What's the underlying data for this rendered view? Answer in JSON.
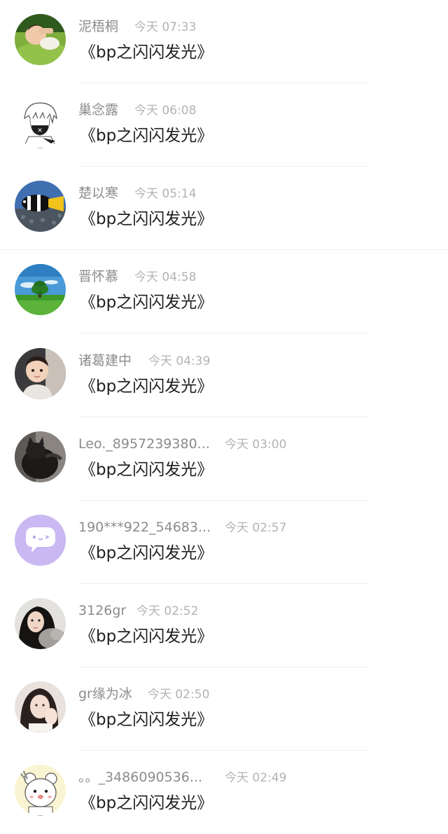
{
  "messages": [
    {
      "name": "泥梧桐",
      "time": "今天 07:33",
      "text": "《bp之闪闪发光》",
      "avatar": "boy-on-grass"
    },
    {
      "name": "巢念露",
      "time": "今天 06:08",
      "text": "《bp之闪闪发光》",
      "avatar": "anime-mask-sketch"
    },
    {
      "name": "楚以寒",
      "time": "今天 05:14",
      "text": "《bp之闪闪发光》",
      "avatar": "clownfish"
    },
    {
      "name": "晋怀慕",
      "time": "今天 04:58",
      "text": "《bp之闪闪发光》",
      "avatar": "tree-landscape"
    },
    {
      "name": "诸葛建中",
      "time": "今天 04:39",
      "text": "《bp之闪闪发光》",
      "avatar": "toddler"
    },
    {
      "name": "Leo._8957239380...",
      "time": "今天 03:00",
      "text": "《bp之闪闪发光》",
      "avatar": "dark-cat"
    },
    {
      "name": "190***922_54683...",
      "time": "今天 02:57",
      "text": "《bp之闪闪发光》",
      "avatar": "purple-chat-bubble"
    },
    {
      "name": "3126gr",
      "time": "今天 02:52",
      "text": "《bp之闪闪发光》",
      "avatar": "girl-with-cat"
    },
    {
      "name": "gr缘为冰",
      "time": "今天 02:50",
      "text": "《bp之闪闪发光》",
      "avatar": "girl-selfie"
    },
    {
      "name": "。。_3486090536...",
      "time": "今天 02:49",
      "text": "《bp之闪闪发光》",
      "avatar": "cartoon-bear"
    }
  ]
}
